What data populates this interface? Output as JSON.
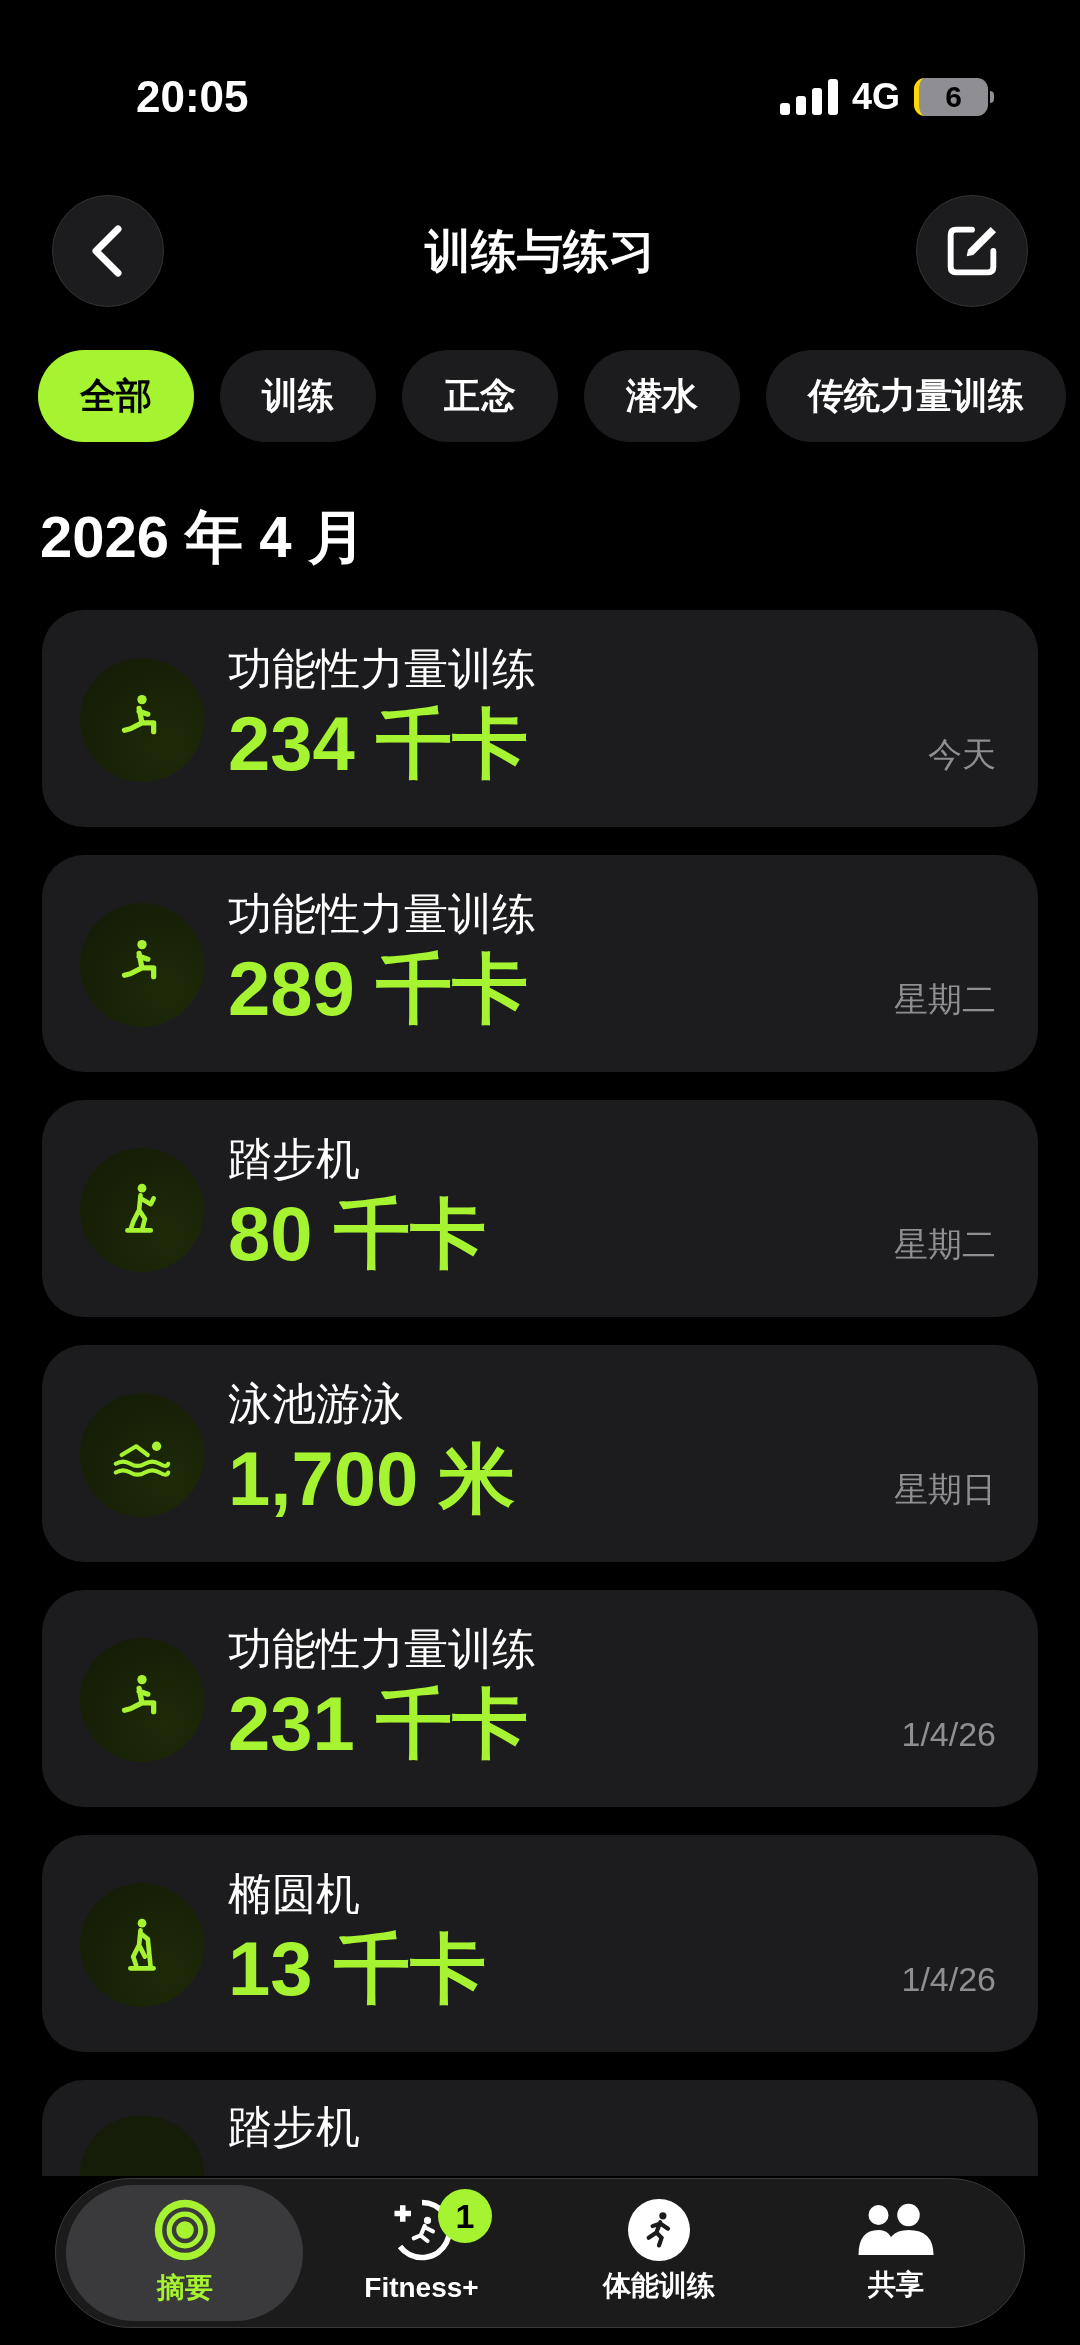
{
  "status_bar": {
    "time": "20:05",
    "network": "4G",
    "battery": "6"
  },
  "header": {
    "title": "训练与练习"
  },
  "filters": [
    {
      "label": "全部",
      "selected": true
    },
    {
      "label": "训练",
      "selected": false
    },
    {
      "label": "正念",
      "selected": false
    },
    {
      "label": "潜水",
      "selected": false
    },
    {
      "label": "传统力量训练",
      "selected": false
    }
  ],
  "month": "2026 年 4 月",
  "workouts": [
    {
      "kind": "strength",
      "name": "功能性力量训练",
      "value": "234 千卡",
      "date": "今天"
    },
    {
      "kind": "strength",
      "name": "功能性力量训练",
      "value": "289 千卡",
      "date": "星期二"
    },
    {
      "kind": "stepper",
      "name": "踏步机",
      "value": "80 千卡",
      "date": "星期二"
    },
    {
      "kind": "swim",
      "name": "泳池游泳",
      "value": "1,700 米",
      "date": "星期日"
    },
    {
      "kind": "strength",
      "name": "功能性力量训练",
      "value": "231 千卡",
      "date": "1/4/26"
    },
    {
      "kind": "elliptical",
      "name": "椭圆机",
      "value": "13 千卡",
      "date": "1/4/26"
    },
    {
      "name": "踏步机"
    }
  ],
  "tab_bar": [
    {
      "kind": "rings",
      "label": "摘要",
      "selected": true
    },
    {
      "kind": "fitness",
      "label": "Fitness+",
      "selected": false,
      "badge": "1"
    },
    {
      "kind": "runner",
      "label": "体能训练",
      "selected": false
    },
    {
      "kind": "people",
      "label": "共享",
      "selected": false
    }
  ]
}
